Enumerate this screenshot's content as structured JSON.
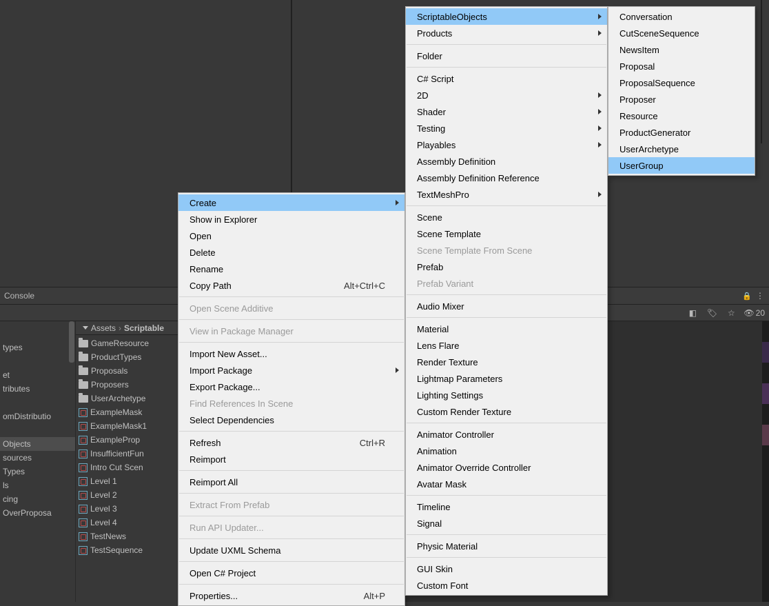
{
  "console": {
    "label": "Console",
    "count": "20"
  },
  "breadcrumb": {
    "root": "Assets",
    "cur": "Scriptable"
  },
  "leftTree": {
    "items": [
      "types",
      "",
      "et",
      "tributes",
      "",
      "omDistributio",
      "",
      "Objects",
      "sources",
      "Types",
      "ls",
      "cing",
      "OverProposa"
    ],
    "selectedIndex": 7
  },
  "folders": [
    "GameResource",
    "ProductTypes",
    "Proposals",
    "Proposers",
    "UserArchetype"
  ],
  "sobjects": [
    "ExampleMask",
    "ExampleMask1",
    "ExampleProp",
    "InsufficientFun",
    "Intro Cut Scen",
    "Level 1",
    "Level 2",
    "Level 3",
    "Level 4",
    "TestNews",
    "TestSequence"
  ],
  "contextMenu": [
    {
      "label": "Create",
      "sub": true,
      "hl": true
    },
    {
      "label": "Show in Explorer"
    },
    {
      "label": "Open"
    },
    {
      "label": "Delete"
    },
    {
      "label": "Rename"
    },
    {
      "label": "Copy Path",
      "shortcut": "Alt+Ctrl+C"
    },
    {
      "sep": true
    },
    {
      "label": "Open Scene Additive",
      "disabled": true
    },
    {
      "sep": true
    },
    {
      "label": "View in Package Manager",
      "disabled": true
    },
    {
      "sep": true
    },
    {
      "label": "Import New Asset..."
    },
    {
      "label": "Import Package",
      "sub": true
    },
    {
      "label": "Export Package..."
    },
    {
      "label": "Find References In Scene",
      "disabled": true
    },
    {
      "label": "Select Dependencies"
    },
    {
      "sep": true
    },
    {
      "label": "Refresh",
      "shortcut": "Ctrl+R"
    },
    {
      "label": "Reimport"
    },
    {
      "sep": true
    },
    {
      "label": "Reimport All"
    },
    {
      "sep": true
    },
    {
      "label": "Extract From Prefab",
      "disabled": true
    },
    {
      "sep": true
    },
    {
      "label": "Run API Updater...",
      "disabled": true
    },
    {
      "sep": true
    },
    {
      "label": "Update UXML Schema"
    },
    {
      "sep": true
    },
    {
      "label": "Open C# Project"
    },
    {
      "sep": true
    },
    {
      "label": "Properties...",
      "shortcut": "Alt+P"
    }
  ],
  "createMenu": [
    {
      "label": "ScriptableObjects",
      "sub": true,
      "hl": true
    },
    {
      "label": "Products",
      "sub": true
    },
    {
      "sep": true
    },
    {
      "label": "Folder"
    },
    {
      "sep": true
    },
    {
      "label": "C# Script"
    },
    {
      "label": "2D",
      "sub": true
    },
    {
      "label": "Shader",
      "sub": true
    },
    {
      "label": "Testing",
      "sub": true
    },
    {
      "label": "Playables",
      "sub": true
    },
    {
      "label": "Assembly Definition"
    },
    {
      "label": "Assembly Definition Reference"
    },
    {
      "label": "TextMeshPro",
      "sub": true
    },
    {
      "sep": true
    },
    {
      "label": "Scene"
    },
    {
      "label": "Scene Template"
    },
    {
      "label": "Scene Template From Scene",
      "disabled": true
    },
    {
      "label": "Prefab"
    },
    {
      "label": "Prefab Variant",
      "disabled": true
    },
    {
      "sep": true
    },
    {
      "label": "Audio Mixer"
    },
    {
      "sep": true
    },
    {
      "label": "Material"
    },
    {
      "label": "Lens Flare"
    },
    {
      "label": "Render Texture"
    },
    {
      "label": "Lightmap Parameters"
    },
    {
      "label": "Lighting Settings"
    },
    {
      "label": "Custom Render Texture"
    },
    {
      "sep": true
    },
    {
      "label": "Animator Controller"
    },
    {
      "label": "Animation"
    },
    {
      "label": "Animator Override Controller"
    },
    {
      "label": "Avatar Mask"
    },
    {
      "sep": true
    },
    {
      "label": "Timeline"
    },
    {
      "label": "Signal"
    },
    {
      "sep": true
    },
    {
      "label": "Physic Material"
    },
    {
      "sep": true
    },
    {
      "label": "GUI Skin"
    },
    {
      "label": "Custom Font"
    }
  ],
  "scriptableMenu": [
    {
      "label": "Conversation"
    },
    {
      "label": "CutSceneSequence"
    },
    {
      "label": "NewsItem"
    },
    {
      "label": "Proposal"
    },
    {
      "label": "ProposalSequence"
    },
    {
      "label": "Proposer"
    },
    {
      "label": "Resource"
    },
    {
      "label": "ProductGenerator"
    },
    {
      "label": "UserArchetype"
    },
    {
      "label": "UserGroup",
      "hl": true
    }
  ]
}
